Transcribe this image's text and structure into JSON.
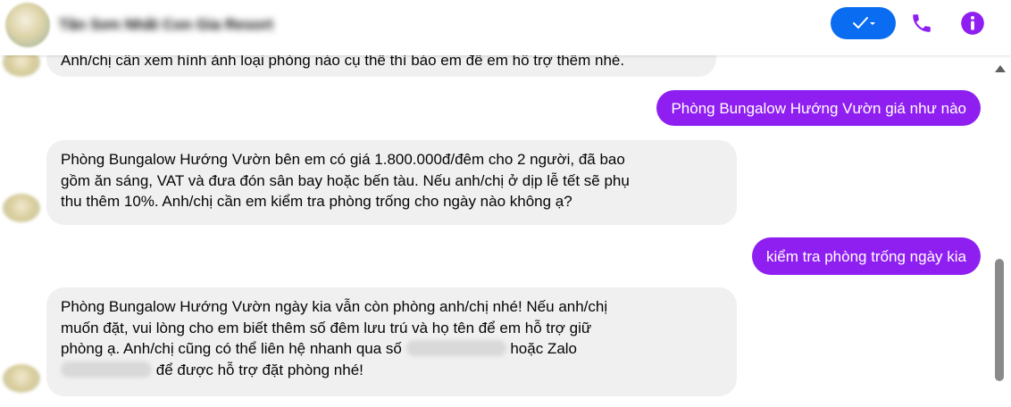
{
  "header": {
    "contact_name": "Tân Sơn Nhất Con Gia Resort",
    "verify_icon": "check-dropdown-icon",
    "call_icon": "phone-icon",
    "info_icon": "info-icon",
    "accent_color": "#8f1ff1",
    "verify_color": "#0a6cf0"
  },
  "messages": [
    {
      "from": "page",
      "text": "Anh/chị cần xem hình ảnh loại phòng nào cụ thể thì báo em để em hỗ trợ thêm nhé."
    },
    {
      "from": "user",
      "text": "Phòng Bungalow Hướng Vườn giá như nào"
    },
    {
      "from": "page",
      "text": "Phòng Bungalow Hướng Vườn bên em có giá 1.800.000đ/đêm cho 2 người, đã bao\ngồm ăn sáng, VAT và đưa đón sân bay hoặc bến tàu. Nếu anh/chị ở dịp lễ tết sẽ phụ\nthu thêm 10%. Anh/chị cần em kiểm tra phòng trống cho ngày nào không ạ?"
    },
    {
      "from": "user",
      "text": "kiểm tra phòng trống ngày kia"
    },
    {
      "from": "page",
      "text_l1": "Phòng Bungalow Hướng Vườn ngày kia vẫn còn phòng anh/chị nhé! Nếu anh/chị",
      "text_l2": "muốn đặt, vui lòng cho em biết thêm số đêm lưu trú và họ tên để em hỗ trợ giữ",
      "text_l3a": "phòng ạ. Anh/chị cũng có thể liên hệ nhanh qua số",
      "text_l3b": "hoặc Zalo",
      "text_l4b": "để được hỗ trợ đặt phòng nhé!"
    }
  ]
}
